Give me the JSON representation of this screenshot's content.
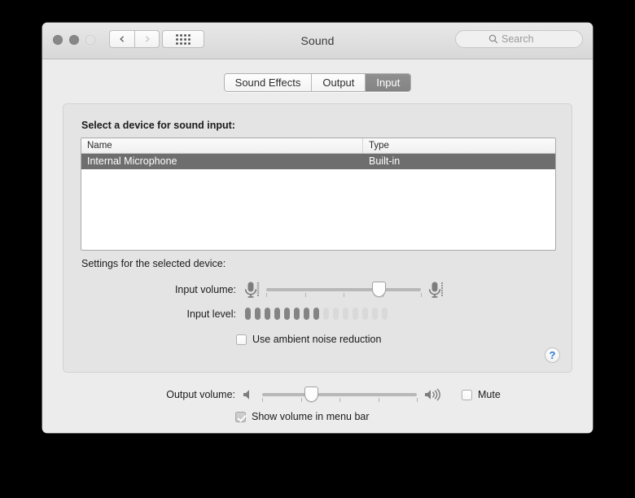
{
  "window": {
    "title": "Sound",
    "traffic_lights": [
      "close-button",
      "minimize-button",
      "zoom-button"
    ],
    "nav": {
      "back_icon": "chevron-left-icon",
      "forward_icon": "chevron-right-icon",
      "grid_icon": "show-all-grid-icon"
    },
    "search": {
      "icon": "search-icon",
      "placeholder": "Search",
      "value": ""
    }
  },
  "tabs": [
    {
      "label": "Sound Effects",
      "selected": false
    },
    {
      "label": "Output",
      "selected": false
    },
    {
      "label": "Input",
      "selected": true
    }
  ],
  "panel": {
    "select_device_label": "Select a device for sound input:",
    "settings_label": "Settings for the selected device:",
    "table": {
      "columns": [
        "Name",
        "Type"
      ],
      "rows": [
        {
          "name": "Internal Microphone",
          "type": "Built-in",
          "selected": true
        }
      ]
    },
    "input_volume": {
      "label": "Input volume:",
      "left_icon": "microphone-low-icon",
      "right_icon": "microphone-high-icon",
      "value_percent": 73,
      "tick_count": 5
    },
    "input_level": {
      "label": "Input level:",
      "segments_total": 15,
      "segments_lit": 8
    },
    "ambient_noise": {
      "label": "Use ambient noise reduction",
      "checked": false
    },
    "help": {
      "icon": "help-question-icon",
      "glyph": "?"
    }
  },
  "bottom": {
    "output_volume": {
      "label": "Output volume:",
      "left_icon": "speaker-mute-icon",
      "right_icon": "speaker-loud-icon",
      "value_percent": 32,
      "tick_count": 5
    },
    "mute": {
      "label": "Mute",
      "checked": false
    },
    "show_volume_menu_bar": {
      "label": "Show volume in menu bar",
      "checked": true
    }
  },
  "colors": {
    "window_bg": "#ececec",
    "panel_bg": "#e4e4e4",
    "selection": "#6e6e6e",
    "accent_help": "#2d7dd6",
    "meter_on": "#848484",
    "meter_off": "#d9d9d9"
  }
}
